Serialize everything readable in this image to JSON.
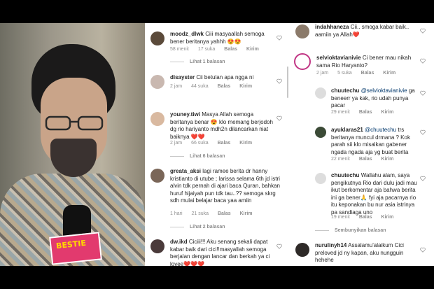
{
  "mid": {
    "comments": [
      {
        "user": "moodz_dlwk",
        "text": "Ciii masyaallah semoga bener beritanya yahhh 😍😍",
        "time": "58 menit",
        "likes": "17 suka",
        "reply": "Balas",
        "send": "Kirim",
        "more": "Lihat 1 balasan"
      },
      {
        "user": "disayster",
        "text": "Cii betulan apa ngga ni",
        "time": "2 jam",
        "likes": "44 suka",
        "reply": "Balas",
        "send": "Kirim"
      },
      {
        "user": "youney.tiwi",
        "text": "Masya Allah semoga beritanya benar 😍 klo memang berjodoh dg rio hariyanto mdh2n dilancarkan niat baiknya ❤️❤️",
        "time": "2 jam",
        "likes": "66 suka",
        "reply": "Balas",
        "send": "Kirim",
        "more": "Lihat 6 balasan"
      },
      {
        "user": "greata_aksi",
        "text": "lagi ramee berita dr hanny kristianto di utube ; larissa selama 6th jd istri alvin tdk pernah di ajari baca Quran, bahkan huruf hijaiyah pun tdk tau..?? semoga skrg sdh mulai belajar baca yaa amiin",
        "time": "1 hari",
        "likes": "21 suka",
        "reply": "Balas",
        "send": "Kirim",
        "more": "Lihat 2 balasan"
      },
      {
        "user": "dw.ikd",
        "text": "Ciciii!!! Aku senang sekali dapat kabar baik dari cici!!masyallah semoga berjalan dengan lancar dan berkah ya ci lovee❤️❤️❤️"
      }
    ]
  },
  "right": {
    "comments": [
      {
        "user": "indahhaneza",
        "text": "Cii.. smoga kabar baik.. aamiin ya Allah❤️"
      },
      {
        "user": "selvioktavianivie",
        "text": "Ci bener mau nikah sama Rio Haryanto?",
        "time": "2 jam",
        "likes": "5 suka",
        "reply": "Balas",
        "send": "Kirim"
      },
      {
        "user": "chuutechu",
        "text": "@selvioktavianivie ga beneerr ya kak, rio udah punya pacar",
        "mention": "@selvioktavianivie",
        "rest": " ga beneerr ya kak, rio udah punya pacar",
        "time": "29 menit",
        "reply": "Balas",
        "send": "Kirim"
      },
      {
        "user": "ayuklaras21",
        "mention": "@chuutechu",
        "rest": " trs beritanya muncul drmana ? Kok parah sii klo misalkan gabener ngada ngada aja yg buat berita",
        "time": "22 menit",
        "reply": "Balas",
        "send": "Kirim"
      },
      {
        "user": "chuutechu",
        "text": "Wallahu alam, saya pengikutnya Rio dari dulu jadi mau ikut berkomentar aja bahwa berita ini ga bener🙏 fyi aja pacarnya rio itu keponakan bu nur asia istrinya pa sandiaga uno",
        "time": "19 menit",
        "reply": "Balas",
        "send": "Kirim"
      },
      {
        "user": "nurulinyh14",
        "text": "Assalamu'alaikum Cici preloved jd ny kapan, aku nungguin hehehe"
      }
    ],
    "hide_replies": "Sembunyikan balasan"
  },
  "video": {
    "mic_label": "BESTIE"
  },
  "colors": {
    "heart": "#e0245e",
    "meta": "#8e8e8e",
    "text": "#262626"
  }
}
